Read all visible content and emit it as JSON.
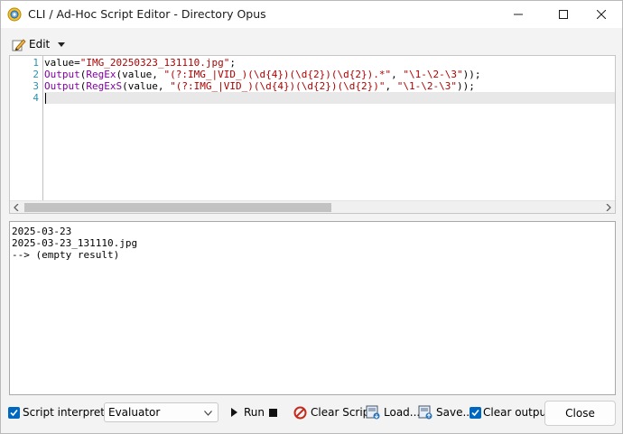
{
  "window": {
    "title": "CLI / Ad-Hoc Script Editor - Directory Opus"
  },
  "menu": {
    "edit_label": "Edit"
  },
  "editor": {
    "line_numbers": [
      "1",
      "2",
      "3",
      "4"
    ],
    "lines": [
      {
        "t1": "value=",
        "t2": "\"IMG_20250323_131110.jpg\"",
        "t3": ";"
      },
      {
        "f1": "Output",
        "p1": "(",
        "f2": "RegEx",
        "p2": "(value, ",
        "s1": "\"(?:IMG_|VID_)(\\d{4})(\\d{2})(\\d{2}).*\"",
        "p3": ", ",
        "s2": "\"\\1-\\2-\\3\"",
        "p4": "));"
      },
      {
        "f1": "Output",
        "p1": "(",
        "f2": "RegExS",
        "p2": "(value, ",
        "s1": "\"(?:IMG_|VID_)(\\d{4})(\\d{2})(\\d{2})\"",
        "p3": ", ",
        "s2": "\"\\1-\\2-\\3\"",
        "p4": "));"
      },
      {
        "text": ""
      }
    ]
  },
  "output": {
    "lines": [
      "2025-03-23",
      "2025-03-23_131110.jpg",
      "--> (empty result)"
    ]
  },
  "bottom": {
    "script_interpreter_label": "Script interpreter:",
    "script_interpreter_checked": true,
    "interpreter_value": "Evaluator",
    "run_label": "Run",
    "clear_script_label": "Clear Script",
    "load_label": "Load...",
    "save_label": "Save...",
    "clear_output_label": "Clear output",
    "clear_output_checked": true,
    "close_label": "Close"
  },
  "colors": {
    "accent": "#0067c0",
    "function": "#8000a0",
    "string": "#b00000",
    "line_number": "#2b91af"
  }
}
